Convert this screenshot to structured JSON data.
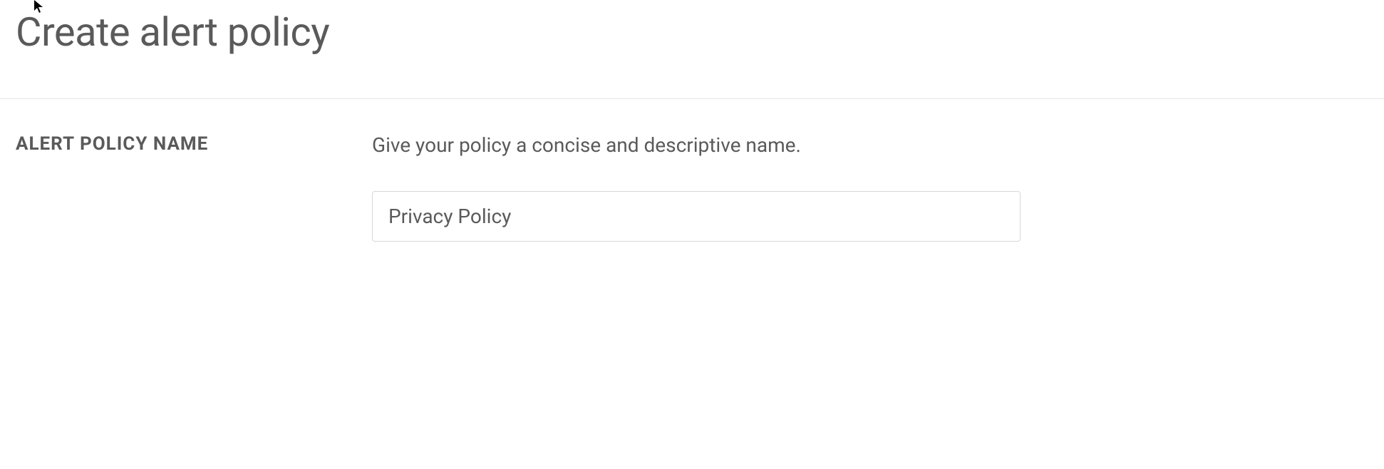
{
  "header": {
    "title": "Create alert policy"
  },
  "form": {
    "name_section": {
      "label": "ALERT POLICY NAME",
      "description": "Give your policy a concise and descriptive name.",
      "value": "Privacy Policy"
    }
  }
}
